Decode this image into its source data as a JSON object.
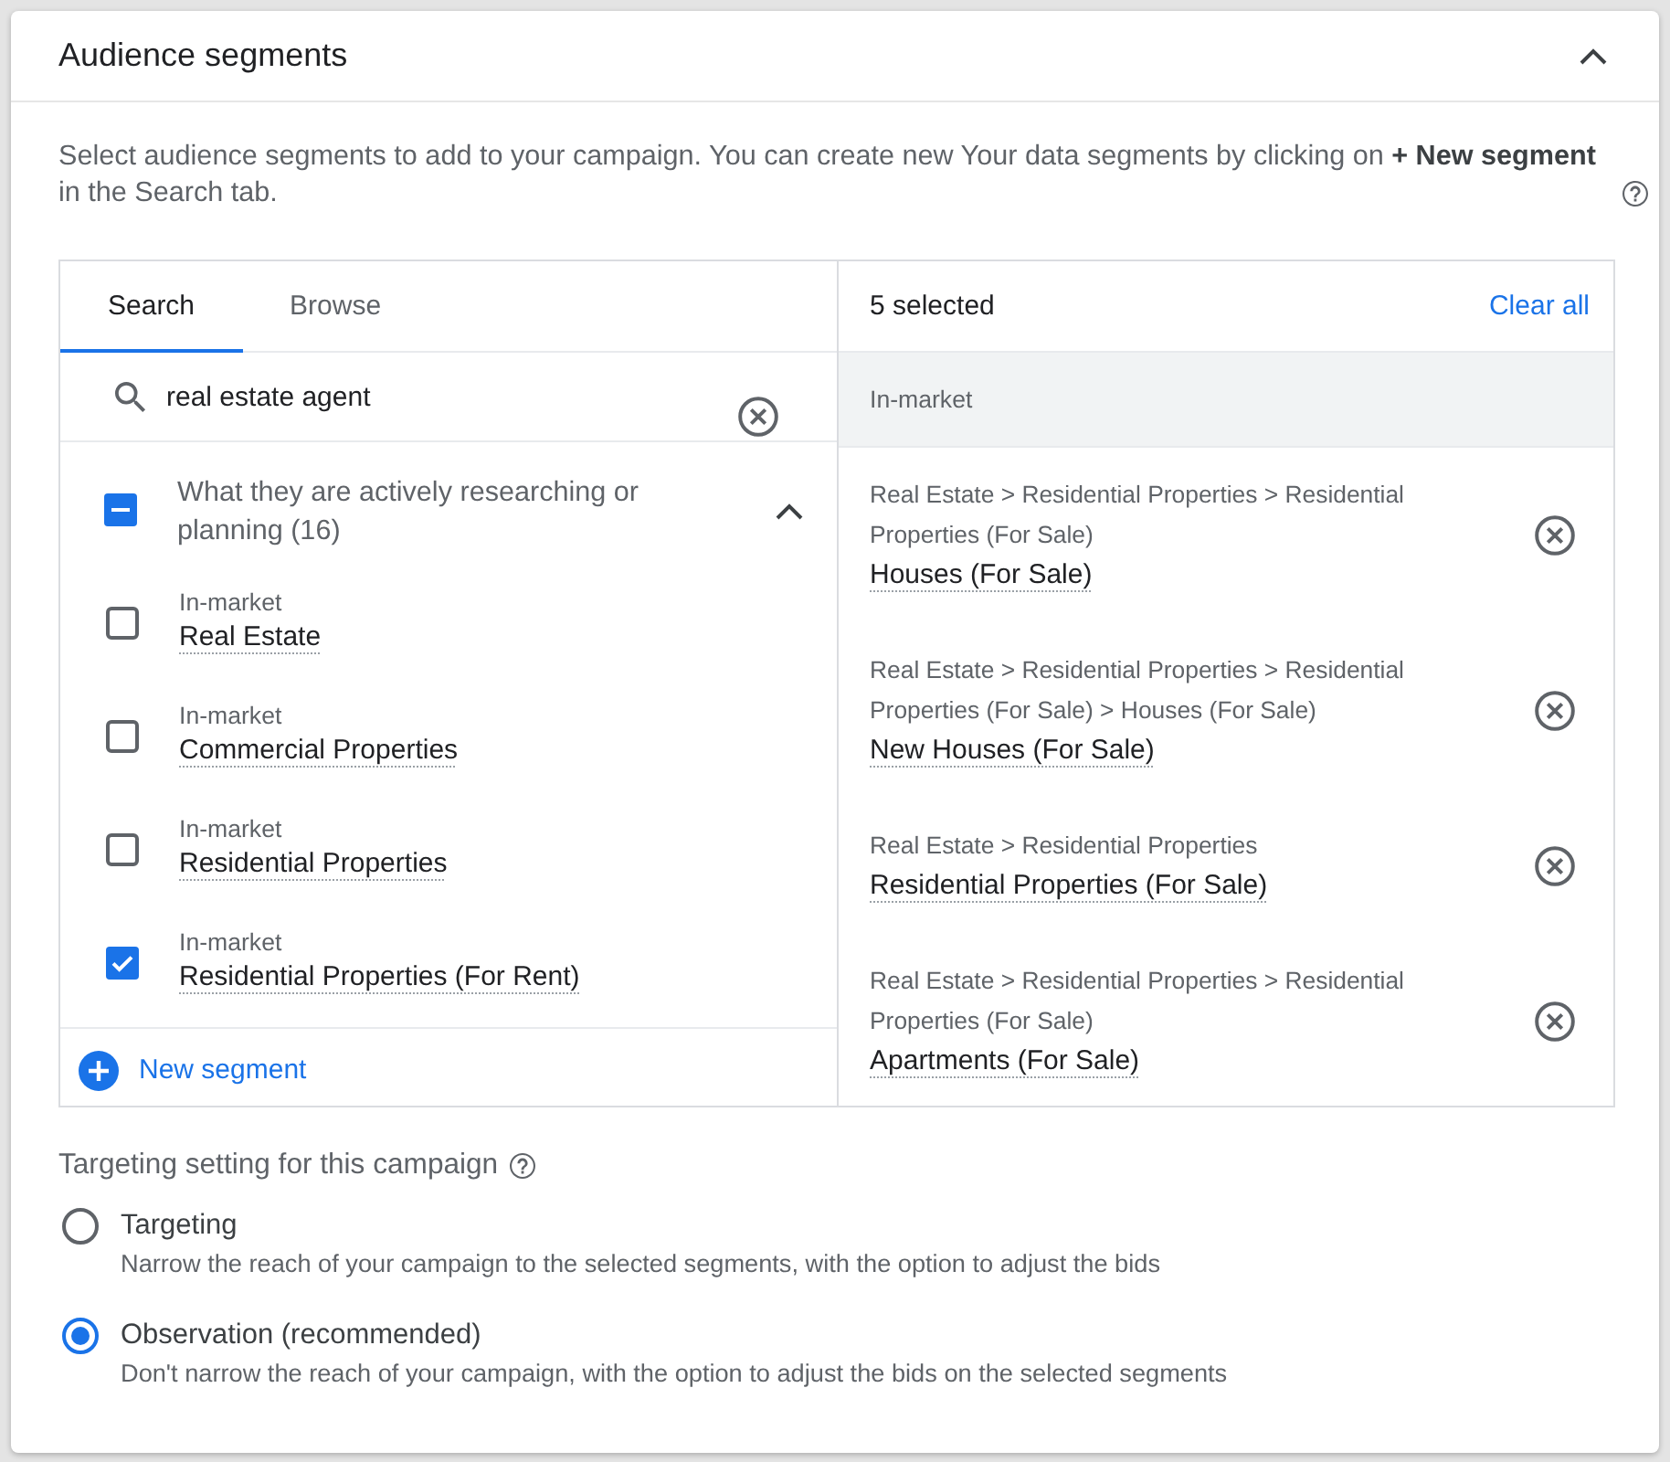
{
  "panel": {
    "title": "Audience segments",
    "expanded": true
  },
  "description": "Select audience segments to add to your campaign. You can create new Your data segments by clicking on **+ New segment** in the Search tab.",
  "picker": {
    "tabs": [
      {
        "label": "Search",
        "selected": true
      },
      {
        "label": "Browse",
        "selected": false
      }
    ],
    "search": {
      "value": "real estate agent"
    },
    "group": {
      "label": "What they are actively researching or planning (16)",
      "checked": false,
      "indeterminate": true,
      "expanded": true
    },
    "items": [
      {
        "category": "In-market",
        "name": "Real Estate",
        "checked": false
      },
      {
        "category": "In-market",
        "name": "Commercial Properties",
        "checked": false
      },
      {
        "category": "In-market",
        "name": "Residential Properties",
        "checked": false
      },
      {
        "category": "In-market",
        "name": "Residential Properties (For Rent)",
        "checked": true
      }
    ],
    "new_segment": "New segment"
  },
  "selection": {
    "count": "5 selected",
    "clear_all": "Clear all",
    "category": "In-market",
    "items": [
      {
        "path": "Real Estate > Residential Properties > Residential Properties (For Sale)",
        "name": "Houses (For Sale)"
      },
      {
        "path": "Real Estate > Residential Properties > Residential Properties (For Sale) > Houses (For Sale)",
        "name": "New Houses (For Sale)"
      },
      {
        "path": "Real Estate > Residential Properties",
        "name": "Residential Properties (For Sale)"
      },
      {
        "path": "Real Estate > Residential Properties > Residential Properties (For Sale)",
        "name": "Apartments (For Sale)"
      }
    ]
  },
  "targeting": {
    "heading": "Targeting setting for this campaign",
    "options": [
      {
        "label": "Targeting",
        "description": "Narrow the reach of your campaign to the selected segments, with the option to adjust the bids",
        "selected": false
      },
      {
        "label": "Observation (recommended)",
        "description": "Don't narrow the reach of your campaign, with the option to adjust the bids on the selected segments",
        "selected": true
      }
    ]
  }
}
